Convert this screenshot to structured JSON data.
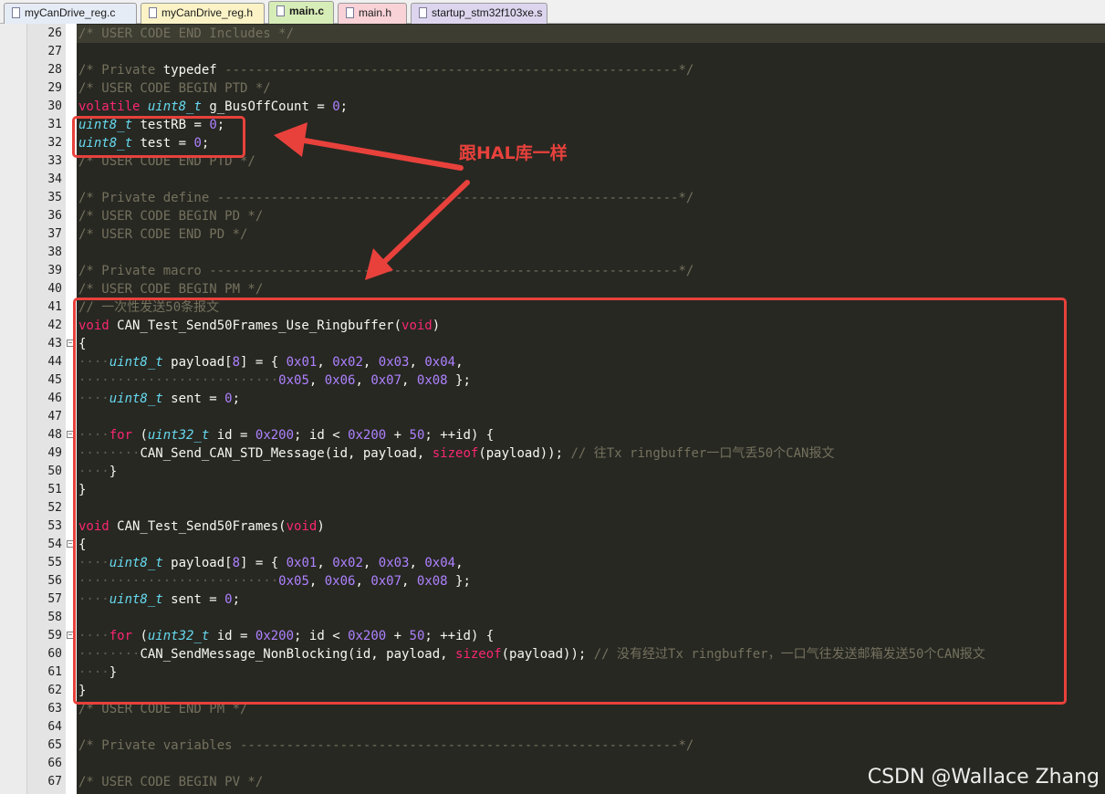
{
  "tabs": [
    {
      "label": "myCanDrive_reg.c",
      "bg": "#e6ecf6",
      "active": false
    },
    {
      "label": "myCanDrive_reg.h",
      "bg": "#fbf3c6",
      "active": false
    },
    {
      "label": "main.c",
      "bg": "#d7edb8",
      "active": true
    },
    {
      "label": "main.h",
      "bg": "#f8d2d7",
      "active": false
    },
    {
      "label": "startup_stm32f103xe.s",
      "bg": "#ddd5ee",
      "active": false
    }
  ],
  "editor": {
    "lines": [
      {
        "n": "26",
        "fold": "",
        "hl": true,
        "segs": [
          [
            "cm",
            "/* USER CODE END Includes */"
          ]
        ]
      },
      {
        "n": "27",
        "fold": "",
        "segs": []
      },
      {
        "n": "28",
        "fold": "",
        "segs": [
          [
            "cm",
            "/* Private "
          ],
          [
            "pl",
            "typedef"
          ],
          [
            "cm",
            " -----------------------------------------------------------*/"
          ]
        ]
      },
      {
        "n": "29",
        "fold": "",
        "segs": [
          [
            "cm",
            "/* USER CODE BEGIN PTD */"
          ]
        ]
      },
      {
        "n": "30",
        "fold": "",
        "segs": [
          [
            "kw",
            "volatile"
          ],
          [
            "pl",
            " "
          ],
          [
            "ty",
            "uint8_t"
          ],
          [
            "pl",
            " g_BusOffCount = "
          ],
          [
            "nm",
            "0"
          ],
          [
            "pl",
            ";"
          ]
        ]
      },
      {
        "n": "31",
        "fold": "",
        "segs": [
          [
            "ty",
            "uint8_t"
          ],
          [
            "pl",
            " testRB = "
          ],
          [
            "nm",
            "0"
          ],
          [
            "pl",
            ";"
          ]
        ]
      },
      {
        "n": "32",
        "fold": "",
        "segs": [
          [
            "ty",
            "uint8_t"
          ],
          [
            "pl",
            " test = "
          ],
          [
            "nm",
            "0"
          ],
          [
            "pl",
            ";"
          ]
        ]
      },
      {
        "n": "33",
        "fold": "",
        "segs": [
          [
            "cm",
            "/* USER CODE END PTD */"
          ]
        ]
      },
      {
        "n": "34",
        "fold": "",
        "segs": []
      },
      {
        "n": "35",
        "fold": "",
        "segs": [
          [
            "cm",
            "/* Private define ------------------------------------------------------------*/"
          ]
        ]
      },
      {
        "n": "36",
        "fold": "",
        "segs": [
          [
            "cm",
            "/* USER CODE BEGIN PD */"
          ]
        ]
      },
      {
        "n": "37",
        "fold": "",
        "segs": [
          [
            "cm",
            "/* USER CODE END PD */"
          ]
        ]
      },
      {
        "n": "38",
        "fold": "",
        "segs": []
      },
      {
        "n": "39",
        "fold": "",
        "segs": [
          [
            "cm",
            "/* Private macro -------------------------------------------------------------*/"
          ]
        ]
      },
      {
        "n": "40",
        "fold": "",
        "segs": [
          [
            "cm",
            "/* USER CODE BEGIN PM */"
          ]
        ]
      },
      {
        "n": "41",
        "fold": "",
        "segs": [
          [
            "cm",
            "// 一次性发送50条报文"
          ]
        ]
      },
      {
        "n": "42",
        "fold": "",
        "segs": [
          [
            "kw",
            "void"
          ],
          [
            "pl",
            " CAN_Test_Send50Frames_Use_Ringbuffer("
          ],
          [
            "kw",
            "void"
          ],
          [
            "pl",
            ")"
          ]
        ]
      },
      {
        "n": "43",
        "fold": "−",
        "segs": [
          [
            "pl",
            "{"
          ]
        ]
      },
      {
        "n": "44",
        "fold": "│",
        "segs": [
          [
            "ws",
            "····"
          ],
          [
            "ty",
            "uint8_t"
          ],
          [
            "pl",
            " payload["
          ],
          [
            "nm",
            "8"
          ],
          [
            "pl",
            "] = { "
          ],
          [
            "nm",
            "0x01"
          ],
          [
            "pl",
            ", "
          ],
          [
            "nm",
            "0x02"
          ],
          [
            "pl",
            ", "
          ],
          [
            "nm",
            "0x03"
          ],
          [
            "pl",
            ", "
          ],
          [
            "nm",
            "0x04"
          ],
          [
            "pl",
            ","
          ]
        ]
      },
      {
        "n": "45",
        "fold": "│",
        "segs": [
          [
            "ws",
            "··························"
          ],
          [
            "nm",
            "0x05"
          ],
          [
            "pl",
            ", "
          ],
          [
            "nm",
            "0x06"
          ],
          [
            "pl",
            ", "
          ],
          [
            "nm",
            "0x07"
          ],
          [
            "pl",
            ", "
          ],
          [
            "nm",
            "0x08"
          ],
          [
            "pl",
            " };"
          ]
        ]
      },
      {
        "n": "46",
        "fold": "│",
        "segs": [
          [
            "ws",
            "····"
          ],
          [
            "ty",
            "uint8_t"
          ],
          [
            "pl",
            " sent = "
          ],
          [
            "nm",
            "0"
          ],
          [
            "pl",
            ";"
          ]
        ]
      },
      {
        "n": "47",
        "fold": "│",
        "segs": []
      },
      {
        "n": "48",
        "fold": "−",
        "segs": [
          [
            "ws",
            "····"
          ],
          [
            "kw",
            "for"
          ],
          [
            "pl",
            " ("
          ],
          [
            "ty",
            "uint32_t"
          ],
          [
            "pl",
            " id = "
          ],
          [
            "nm",
            "0x200"
          ],
          [
            "pl",
            "; id < "
          ],
          [
            "nm",
            "0x200"
          ],
          [
            "pl",
            " + "
          ],
          [
            "nm",
            "50"
          ],
          [
            "pl",
            "; ++id) {"
          ]
        ]
      },
      {
        "n": "49",
        "fold": "│",
        "segs": [
          [
            "ws",
            "········"
          ],
          [
            "pl",
            "CAN_Send_CAN_STD_Message(id, payload, "
          ],
          [
            "kw",
            "sizeof"
          ],
          [
            "pl",
            "(payload)); "
          ],
          [
            "cm",
            "// 往Tx ringbuffer一口气丢50个CAN报文"
          ]
        ]
      },
      {
        "n": "50",
        "fold": "│",
        "segs": [
          [
            "ws",
            "····"
          ],
          [
            "pl",
            "}"
          ]
        ]
      },
      {
        "n": "51",
        "fold": "└",
        "segs": [
          [
            "pl",
            "}"
          ]
        ]
      },
      {
        "n": "52",
        "fold": "",
        "segs": []
      },
      {
        "n": "53",
        "fold": "",
        "segs": [
          [
            "kw",
            "void"
          ],
          [
            "pl",
            " CAN_Test_Send50Frames("
          ],
          [
            "kw",
            "void"
          ],
          [
            "pl",
            ")"
          ]
        ]
      },
      {
        "n": "54",
        "fold": "−",
        "segs": [
          [
            "pl",
            "{"
          ]
        ]
      },
      {
        "n": "55",
        "fold": "│",
        "segs": [
          [
            "ws",
            "····"
          ],
          [
            "ty",
            "uint8_t"
          ],
          [
            "pl",
            " payload["
          ],
          [
            "nm",
            "8"
          ],
          [
            "pl",
            "] = { "
          ],
          [
            "nm",
            "0x01"
          ],
          [
            "pl",
            ", "
          ],
          [
            "nm",
            "0x02"
          ],
          [
            "pl",
            ", "
          ],
          [
            "nm",
            "0x03"
          ],
          [
            "pl",
            ", "
          ],
          [
            "nm",
            "0x04"
          ],
          [
            "pl",
            ","
          ]
        ]
      },
      {
        "n": "56",
        "fold": "│",
        "segs": [
          [
            "ws",
            "··························"
          ],
          [
            "nm",
            "0x05"
          ],
          [
            "pl",
            ", "
          ],
          [
            "nm",
            "0x06"
          ],
          [
            "pl",
            ", "
          ],
          [
            "nm",
            "0x07"
          ],
          [
            "pl",
            ", "
          ],
          [
            "nm",
            "0x08"
          ],
          [
            "pl",
            " };"
          ]
        ]
      },
      {
        "n": "57",
        "fold": "│",
        "segs": [
          [
            "ws",
            "····"
          ],
          [
            "ty",
            "uint8_t"
          ],
          [
            "pl",
            " sent = "
          ],
          [
            "nm",
            "0"
          ],
          [
            "pl",
            ";"
          ]
        ]
      },
      {
        "n": "58",
        "fold": "│",
        "segs": []
      },
      {
        "n": "59",
        "fold": "−",
        "segs": [
          [
            "ws",
            "····"
          ],
          [
            "kw",
            "for"
          ],
          [
            "pl",
            " ("
          ],
          [
            "ty",
            "uint32_t"
          ],
          [
            "pl",
            " id = "
          ],
          [
            "nm",
            "0x200"
          ],
          [
            "pl",
            "; id < "
          ],
          [
            "nm",
            "0x200"
          ],
          [
            "pl",
            " + "
          ],
          [
            "nm",
            "50"
          ],
          [
            "pl",
            "; ++id) {"
          ]
        ]
      },
      {
        "n": "60",
        "fold": "│",
        "segs": [
          [
            "ws",
            "········"
          ],
          [
            "pl",
            "CAN_SendMessage_NonBlocking(id, payload, "
          ],
          [
            "kw",
            "sizeof"
          ],
          [
            "pl",
            "(payload)); "
          ],
          [
            "cm",
            "// 没有经过Tx ringbuffer，一口气往发送邮箱发送50个CAN报文"
          ]
        ]
      },
      {
        "n": "61",
        "fold": "│",
        "segs": [
          [
            "ws",
            "····"
          ],
          [
            "pl",
            "}"
          ]
        ]
      },
      {
        "n": "62",
        "fold": "└",
        "segs": [
          [
            "pl",
            "}"
          ]
        ]
      },
      {
        "n": "63",
        "fold": "",
        "segs": [
          [
            "cm",
            "/* USER CODE END PM */"
          ]
        ]
      },
      {
        "n": "64",
        "fold": "",
        "segs": []
      },
      {
        "n": "65",
        "fold": "",
        "segs": [
          [
            "cm",
            "/* Private variables ---------------------------------------------------------*/"
          ]
        ]
      },
      {
        "n": "66",
        "fold": "",
        "segs": []
      },
      {
        "n": "67",
        "fold": "",
        "segs": [
          [
            "cm",
            "/* USER CODE BEGIN PV */"
          ]
        ]
      }
    ]
  },
  "annotation": {
    "text": "跟HAL库一样",
    "color": "#e8413c"
  },
  "watermark": "CSDN @Wallace Zhang",
  "theme": {
    "background": "#272822",
    "comment": "#75715e",
    "keyword": "#f92672",
    "type": "#66d9ef",
    "number": "#ae81ff",
    "plain": "#f8f8f2"
  }
}
